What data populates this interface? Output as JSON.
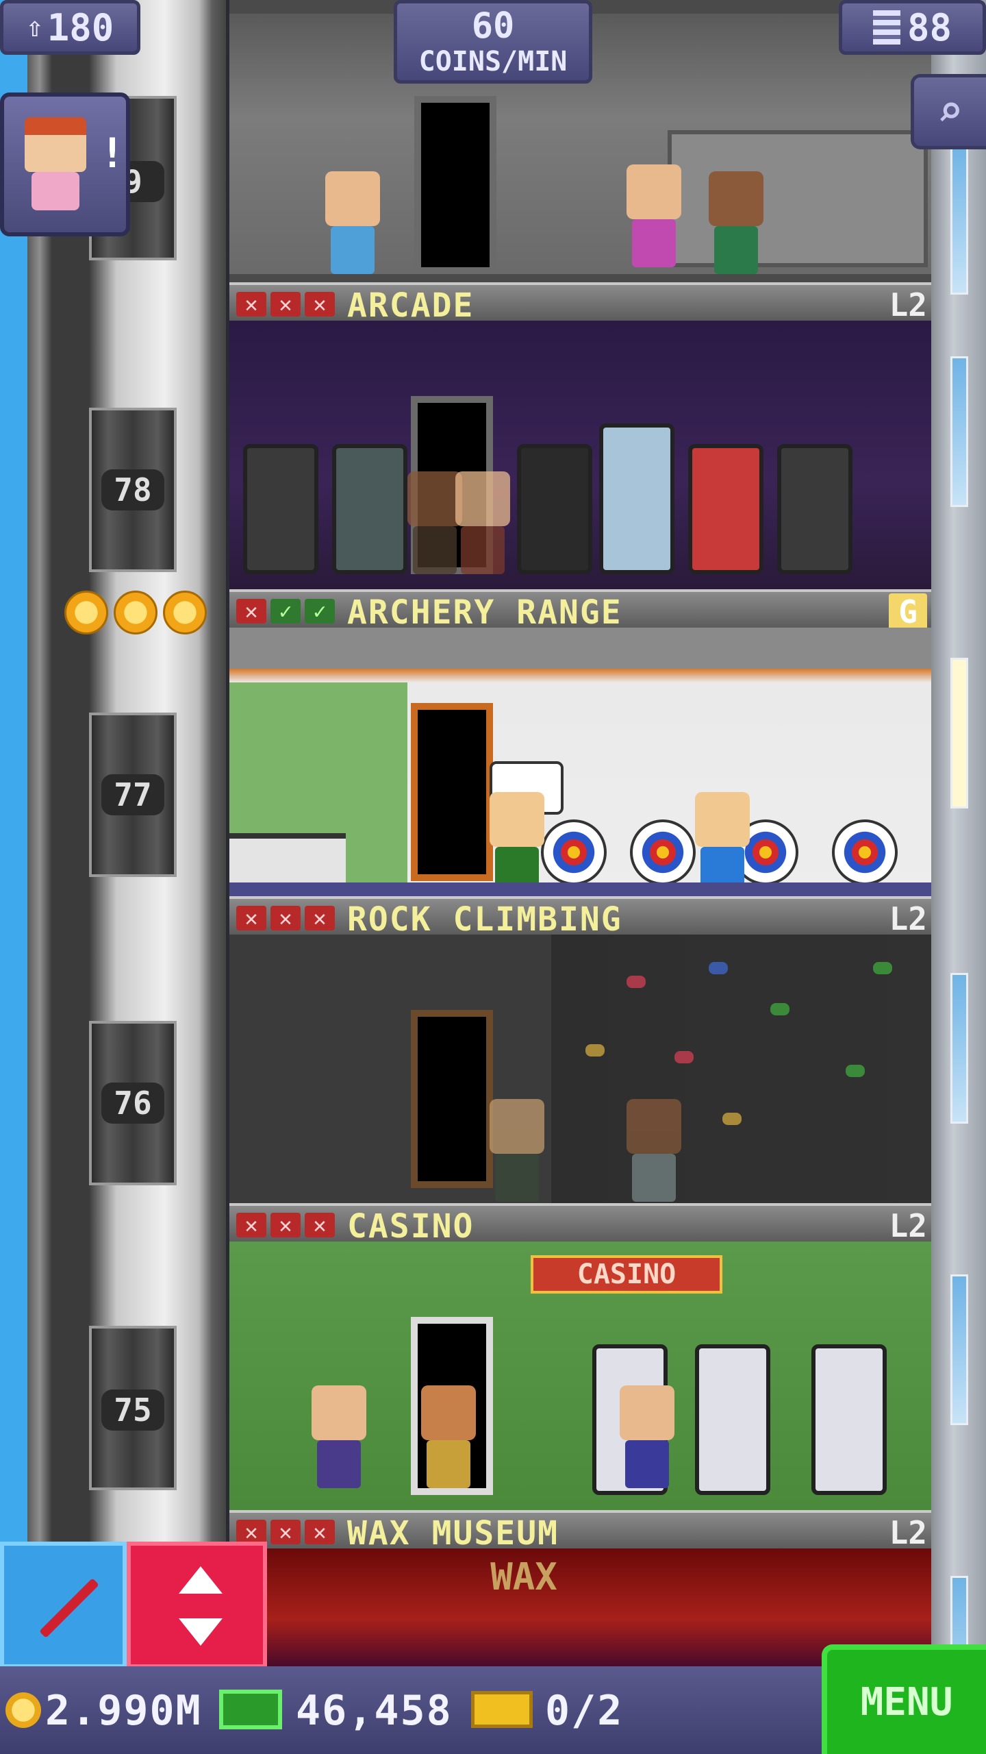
{
  "hud": {
    "population": "180",
    "coins_per_min_value": "60",
    "coins_per_min_label": "COINS/MIN",
    "floors": "88",
    "coins": "2.990M",
    "bux": "46,458",
    "tickets": "0/2",
    "menu_label": "MENU",
    "alert_mark": "!"
  },
  "elevator": {
    "floor_numbers": [
      "9",
      "78",
      "77",
      "76",
      "75"
    ]
  },
  "floors": [
    {
      "name": "ARCADE",
      "level": "L2",
      "stocks": [
        "x",
        "x",
        "x"
      ]
    },
    {
      "name": "ARCHERY RANGE",
      "level": "G",
      "stocks": [
        "x",
        "ok",
        "ok"
      ]
    },
    {
      "name": "ROCK CLIMBING",
      "level": "L2",
      "stocks": [
        "x",
        "x",
        "x"
      ]
    },
    {
      "name": "CASINO",
      "level": "L2",
      "stocks": [
        "x",
        "x",
        "x"
      ]
    },
    {
      "name": "WAX MUSEUM",
      "level": "L2",
      "stocks": [
        "x",
        "x",
        "x"
      ]
    }
  ],
  "signs": {
    "casino_sign": "CASINO",
    "wax_sign": "WAX"
  },
  "colors": {
    "menu_green": "#1fb51f",
    "elevator_red": "#e61e4a",
    "build_blue": "#39a0e8",
    "title_yellow": "#f3ef9a"
  }
}
